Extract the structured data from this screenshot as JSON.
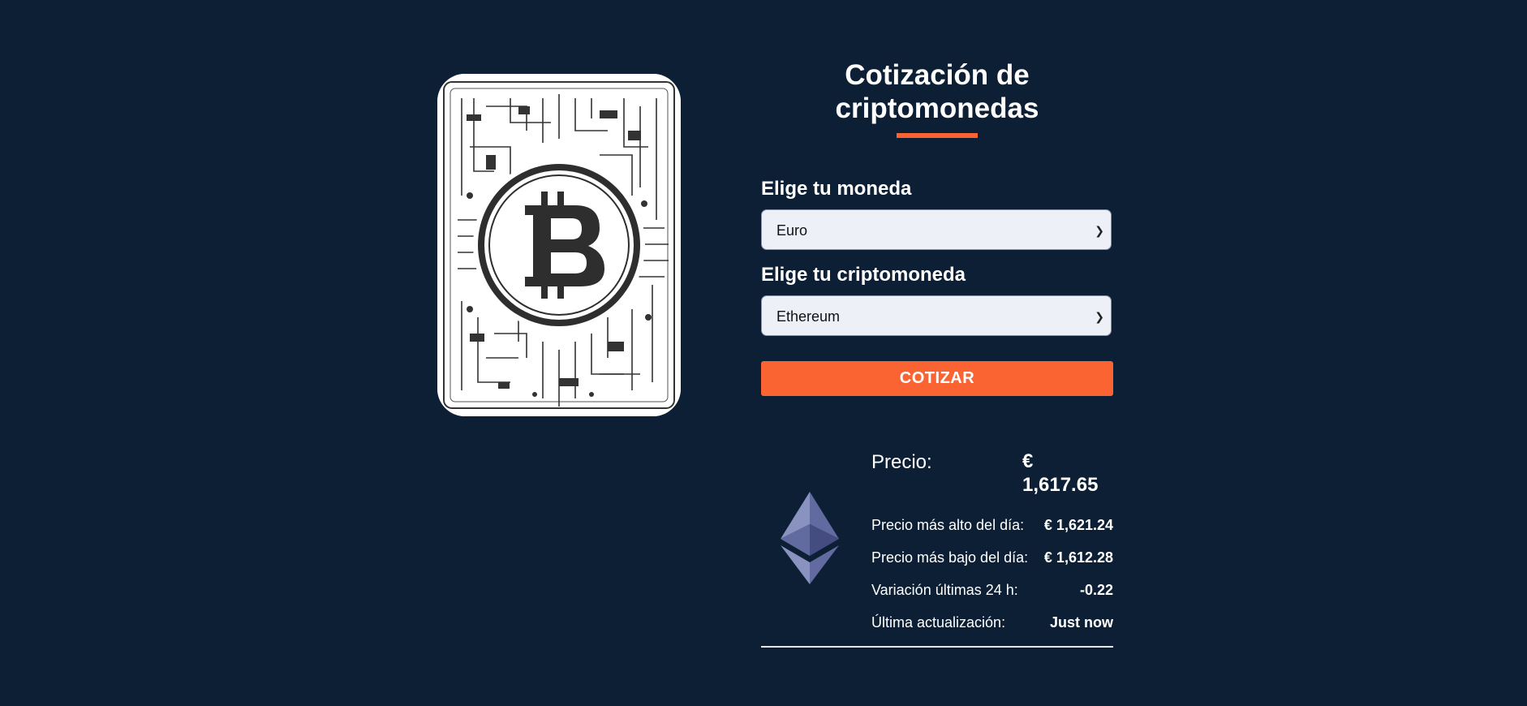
{
  "title": "Cotización de criptomonedas",
  "colors": {
    "background": "#0d1f35",
    "accent": "#fa6433",
    "select_bg": "#eef0f8"
  },
  "hero": {
    "icon": "bitcoin-circuit-icon"
  },
  "form": {
    "currency_label": "Elige tu moneda",
    "currency_value": "Euro",
    "crypto_label": "Elige tu criptomoneda",
    "crypto_value": "Ethereum",
    "submit_label": "COTIZAR"
  },
  "result": {
    "icon": "ethereum-icon",
    "price_label": "Precio:",
    "price_value": "€ 1,617.65",
    "rows": [
      {
        "label": "Precio más alto del día:",
        "value": "€ 1,621.24"
      },
      {
        "label": "Precio más bajo del día:",
        "value": "€ 1,612.28"
      },
      {
        "label": "Variación últimas 24 h:",
        "value": "-0.22"
      },
      {
        "label": "Última actualización:",
        "value": "Just now"
      }
    ]
  }
}
